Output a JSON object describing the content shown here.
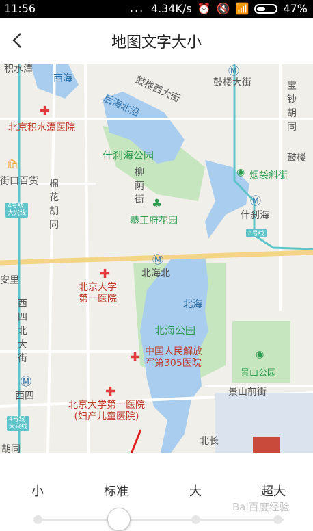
{
  "status_bar": {
    "time": "11:56",
    "dots": "...",
    "speed": "4.34K/s",
    "battery": "47%"
  },
  "header": {
    "title": "地图文字大小"
  },
  "map": {
    "labels": {
      "jishuitan": "积水潭",
      "xihai": "西海",
      "gulou_xi": "鼓楼西大街",
      "gulou_da": "鼓楼大街",
      "baochao": "宝钞胡同",
      "houhai": "后海北沿",
      "jishuitan_hospital": "北京积水潭医院",
      "shichahai_park": "什刹海公园",
      "gulou_edge": "鼓楼",
      "yandai": "烟袋斜街",
      "jiekou": "街口百货",
      "liuyin": "柳荫街",
      "shichahai": "什刹海",
      "line8": "8号线",
      "line4_a": "4号线\n大兴线",
      "mianhua": "棉花胡同",
      "gongwang": "恭王府花园",
      "beihaibei": "北海北",
      "anli": "安里",
      "pku_first": "北京大学\n第一医院",
      "beihai_lake": "北海",
      "xisi_bei": "西四北大街",
      "beihai_park": "北海公园",
      "pla305": "中国人民解放\n军第305医院",
      "jingshan_park": "景山公园",
      "xisi": "西四",
      "jingshan_qian": "景山前街",
      "pku_fuer": "北京大学第一医院\n(妇产儿童医院)",
      "line4_b": "4号线\n大兴线",
      "hutong_bottom": "胡同",
      "bei_bottom": "北长"
    }
  },
  "size_options": [
    "小",
    "标准",
    "大",
    "超大"
  ],
  "selected_size": "标准",
  "watermark": "Bai百度经验",
  "colors": {
    "water": "#a9cdee",
    "park": "#c6e6c0",
    "road_main": "#f4d487",
    "metro": "#5fc4c9",
    "accent_red": "#e03a3a"
  }
}
